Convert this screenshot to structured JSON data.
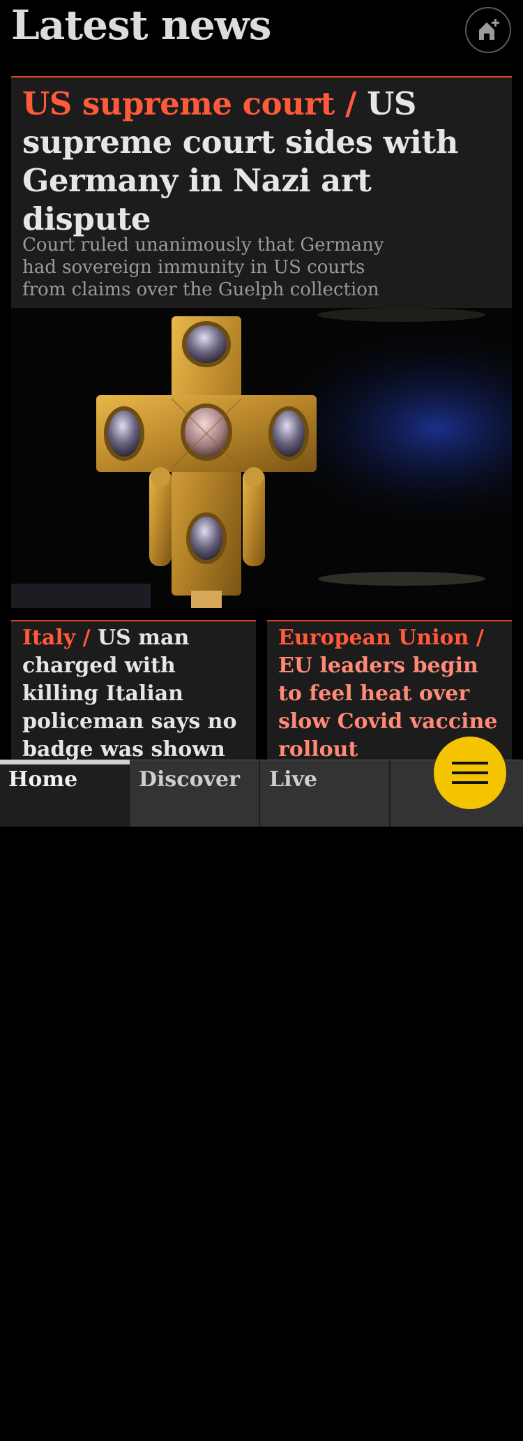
{
  "header": {
    "title": "Latest news",
    "home_icon": "home-plus-icon"
  },
  "lead_story": {
    "kicker": "US supreme court /",
    "headline": "US supreme court sides with Germany in Nazi art dispute",
    "standfirst": "Court ruled unanimously that Germany had sovereign immunity in US courts from claims over the Guelph collection",
    "image": "jeweled-gold-cross-reliquary"
  },
  "cards": [
    {
      "kicker": "Italy /",
      "headline": "US man charged with killing Italian policeman says no badge was shown"
    },
    {
      "kicker": "European Union /",
      "headline": "EU leaders begin to feel heat over slow Covid vaccine rollout"
    }
  ],
  "nav": {
    "tabs": [
      "Home",
      "Discover",
      "Live",
      ""
    ],
    "active": "Home",
    "menu_icon": "hamburger-menu-icon"
  },
  "colors": {
    "kicker": "#ff5a3a",
    "accent_border": "#e4402a",
    "menu_button": "#f5c400",
    "card_bg": "#1c1c1c"
  }
}
